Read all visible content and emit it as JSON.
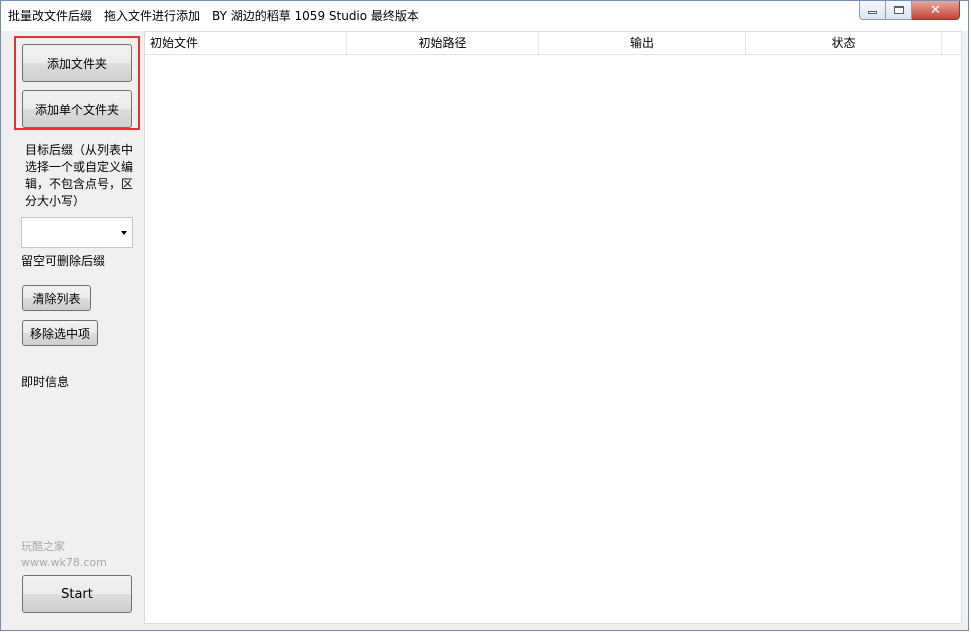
{
  "window": {
    "title": "批量改文件后缀　拖入文件进行添加　BY 湖边的稻草 1059 Studio 最终版本"
  },
  "sidebar": {
    "add_folder_label": "添加文件夹",
    "add_single_folder_label": "添加单个文件夹",
    "suffix_description": "目标后缀（从列表中选择一个或自定义编辑，不包含点号，区分大小写）",
    "suffix_combo_value": "",
    "empty_hint": "留空可删除后缀",
    "clear_list_label": "清除列表",
    "remove_selected_label": "移除选中项",
    "live_info_label": "即时信息",
    "watermark_line1": "玩酷之家",
    "watermark_line2": "www.wk78.com",
    "start_label": "Start"
  },
  "list": {
    "columns": [
      "初始文件",
      "初始路径",
      "输出",
      "状态"
    ],
    "rows": []
  },
  "colors": {
    "highlight": "#e53333",
    "close_button": "#c4443a",
    "window_border": "#6d8fb5"
  },
  "icons": {
    "minimize": "minimize-icon",
    "maximize": "maximize-icon",
    "close": "close-icon",
    "combo_arrow": "chevron-down-icon"
  }
}
